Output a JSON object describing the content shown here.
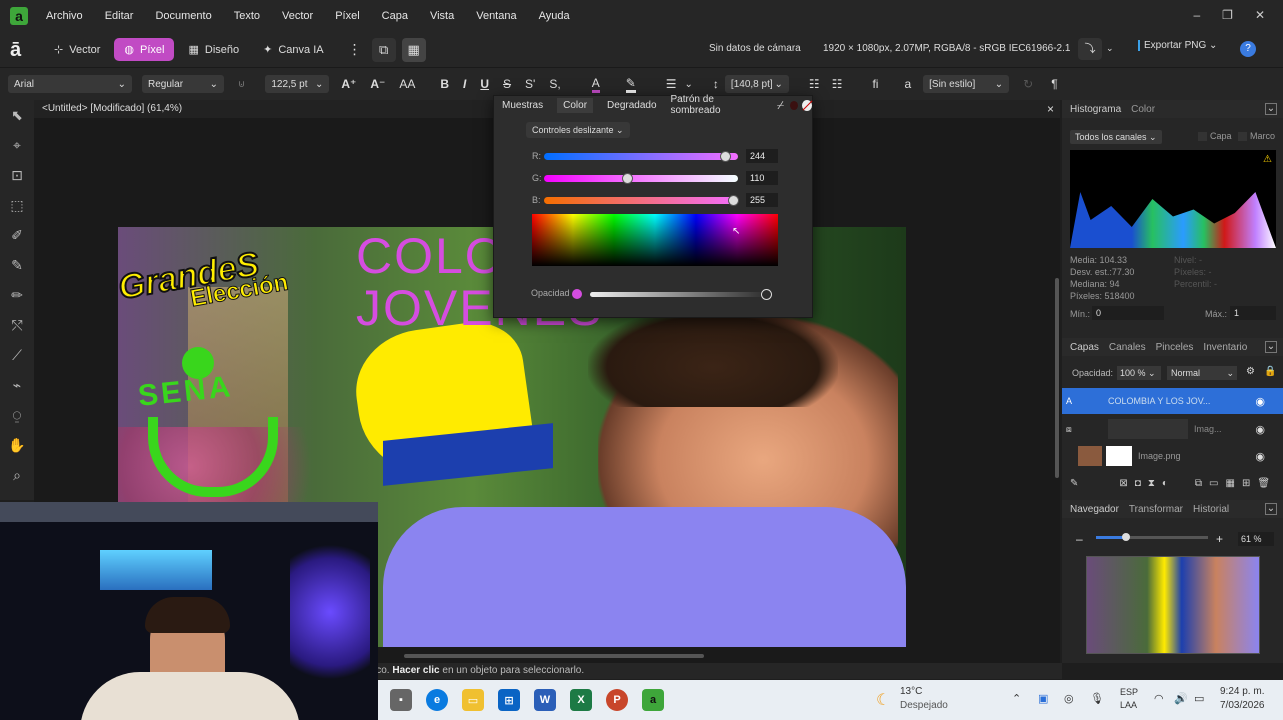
{
  "menubar": {
    "logo": "a",
    "items": [
      "Archivo",
      "Editar",
      "Documento",
      "Texto",
      "Vector",
      "Píxel",
      "Capa",
      "Vista",
      "Ventana",
      "Ayuda"
    ],
    "win_minimize": "–",
    "win_restore": "❐",
    "win_close": "✕"
  },
  "toolbar": {
    "personas": [
      {
        "label": "Vector",
        "icon": "⊹"
      },
      {
        "label": "Píxel",
        "icon": "◍"
      },
      {
        "label": "Diseño",
        "icon": "▦"
      },
      {
        "label": "Canva IA",
        "icon": "✦"
      }
    ],
    "active_persona": "Píxel",
    "more_icon": "⋮",
    "camera_info": "Sin datos de cámara",
    "doc_info": "1920 × 1080px, 2.07MP, RGBA/8 - sRGB IEC61966-2.1",
    "export_label": "Exportar PNG",
    "help_icon": "?"
  },
  "format_bar": {
    "font_family": "Arial",
    "font_style": "Regular",
    "font_size": "122,5 pt",
    "line_spacing": "[140,8 pt]",
    "paragraph_style": "[Sin estilo]",
    "buttons": [
      "A⁺",
      "A⁻",
      "AA",
      "B",
      "I",
      "U",
      "S",
      "S'",
      "S,"
    ]
  },
  "left_tools": [
    "⬉",
    "⌖",
    "⊡",
    "⬚",
    "✐",
    "✎",
    "✏",
    "⤲",
    "⟋",
    "⌁",
    "⍜",
    "✋",
    "⌕"
  ],
  "document": {
    "tab_title": "<Untitled> [Modificado] (61,4%)",
    "close": "×",
    "artboard_text_1": "COLO",
    "artboard_text_2": "JOVENES",
    "logo_line1": "GrandeS",
    "logo_line2": "Elección",
    "sena_text": "SENA"
  },
  "color_popup": {
    "tabs": [
      "Muestras",
      "Color",
      "Degradado",
      "Patrón de sombreado"
    ],
    "active_tab": "Color",
    "mode_label": "Controles deslizante",
    "r_label": "R:",
    "r_value": "244",
    "g_label": "G:",
    "g_value": "110",
    "b_label": "B:",
    "b_value": "255",
    "opacity_label": "Opacidad",
    "current_color": "#f46eff"
  },
  "right_panel": {
    "histogram_tabs": [
      "Histograma",
      "Color"
    ],
    "channels": "Todos los canales",
    "capa": "Capa",
    "marco": "Marco",
    "stats_left": [
      "Media: 104.33",
      "Desv. est.:77.30",
      "Mediana: 94",
      "Píxeles: 518400"
    ],
    "stats_right": [
      "Nivel: -",
      "Píxeles: -",
      "Percentil: -"
    ],
    "min_label": "Mín.:",
    "min_value": "0",
    "max_label": "Máx.:",
    "max_value": "1",
    "layer_tabs": [
      "Capas",
      "Canales",
      "Pinceles",
      "Inventario"
    ],
    "opacity_label": "Opacidad:",
    "opacity_value": "100 %",
    "blend_mode": "Normal",
    "layers": [
      {
        "name": "COLOMBIA Y LOS JOV...",
        "selected": true
      },
      {
        "name": "Imag...",
        "selected": false
      },
      {
        "name": "Image.png",
        "selected": false
      }
    ],
    "nav_tabs": [
      "Navegador",
      "Transformar",
      "Historial"
    ],
    "zoom_value": "61 %",
    "zoom_minus": "–",
    "zoom_plus": "+"
  },
  "status_bar": {
    "prefix": "ico.",
    "bold": "Hacer clic",
    "rest": " en un objeto para seleccionarlo."
  },
  "taskbar": {
    "weather_temp": "13°C",
    "weather_desc": "Despejado",
    "lang_1": "ESP",
    "lang_2": "LAA",
    "time": "9:24 p. m.",
    "date": "7/03/2026"
  },
  "colors": {
    "accent": "#c14bc4",
    "selected_layer": "#2d6fd8",
    "text_magenta": "#d54de0"
  }
}
